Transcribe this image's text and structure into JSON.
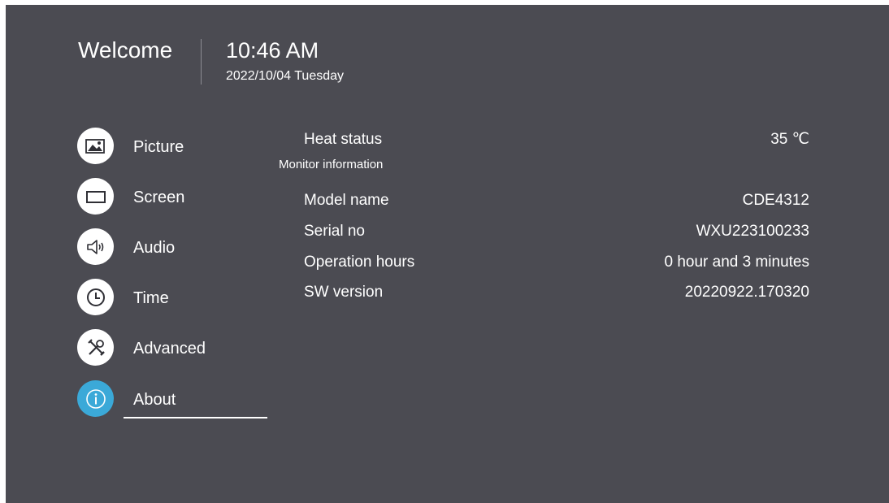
{
  "header": {
    "welcome": "Welcome",
    "time": "10:46 AM",
    "date": "2022/10/04  Tuesday"
  },
  "menu": {
    "items": [
      {
        "label": "Picture",
        "icon": "picture-icon"
      },
      {
        "label": "Screen",
        "icon": "screen-icon"
      },
      {
        "label": "Audio",
        "icon": "speaker-icon"
      },
      {
        "label": "Time",
        "icon": "clock-icon"
      },
      {
        "label": "Advanced",
        "icon": "tools-icon"
      },
      {
        "label": "About",
        "icon": "info-icon",
        "active": true
      }
    ]
  },
  "about": {
    "heat_status_label": "Heat status",
    "heat_status_value": "35 ℃",
    "section_title": "Monitor information",
    "rows": [
      {
        "label": "Model name",
        "value": "CDE4312"
      },
      {
        "label": "Serial no",
        "value": "WXU223100233"
      },
      {
        "label": "Operation hours",
        "value": "0 hour and 3 minutes"
      },
      {
        "label": "SW version",
        "value": "20220922.170320"
      }
    ]
  },
  "colors": {
    "background": "#4b4b52",
    "accent": "#3ba9d8",
    "text": "#ffffff"
  }
}
